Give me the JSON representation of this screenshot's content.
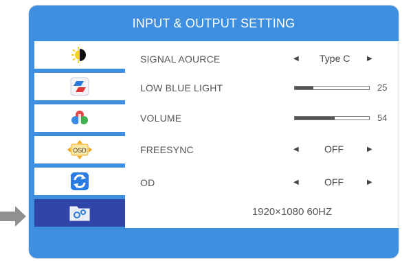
{
  "header": {
    "title": "INPUT & OUTPUT SETTING"
  },
  "sidebar": {
    "items": [
      {
        "icon": "brightness-contrast-icon"
      },
      {
        "icon": "color-icon"
      },
      {
        "icon": "color-settings-icon"
      },
      {
        "icon_text": "OSD",
        "icon": "osd-icon"
      },
      {
        "icon": "reset-icon"
      },
      {
        "icon": "input-output-settings-icon",
        "active": true
      }
    ]
  },
  "settings": [
    {
      "label": "SIGNAL AOURCE",
      "value": "Type C"
    },
    {
      "label": "LOW BLUE LIGHT",
      "value": 25,
      "max": 100
    },
    {
      "label": "VOLUME",
      "value": 54,
      "max": 100
    },
    {
      "label": "FREESYNC",
      "value": "OFF"
    },
    {
      "label": "OD",
      "value": "OFF"
    }
  ],
  "status": {
    "resolution": "1920×1080 60HZ"
  },
  "colors": {
    "frame": "#3f8fe0",
    "active_item": "#2f45a8",
    "pointer": "#909090"
  }
}
